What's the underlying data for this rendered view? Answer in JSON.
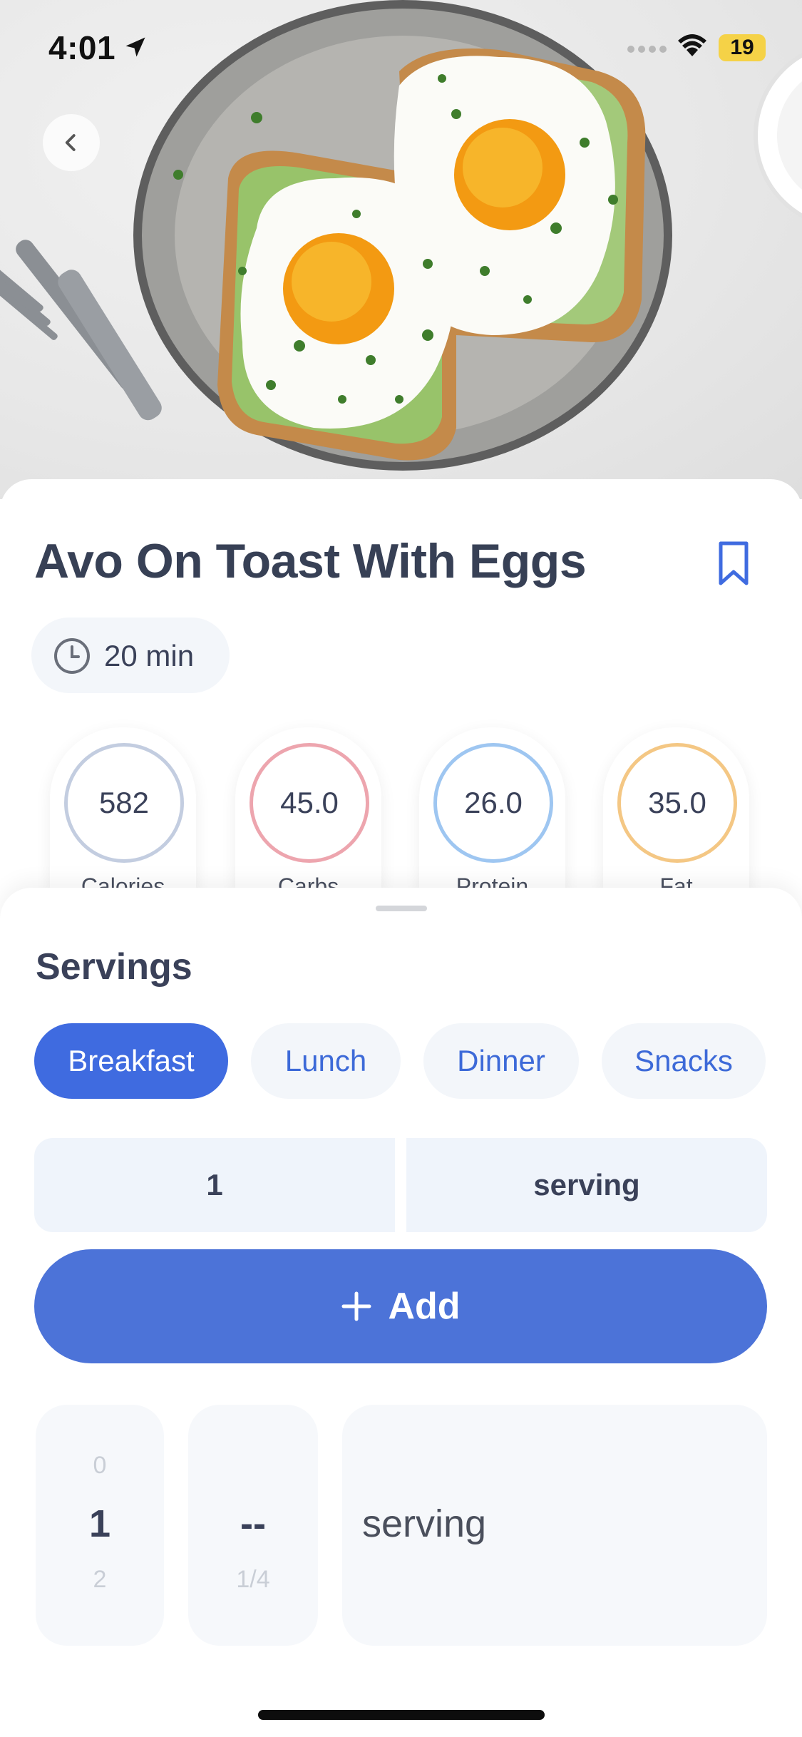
{
  "status_bar": {
    "time": "4:01",
    "battery": "19"
  },
  "recipe": {
    "title": "Avo On Toast With Eggs",
    "cook_time": "20 min"
  },
  "nutrition": [
    {
      "value": "582",
      "label": "Calories",
      "color": "#c3cde0"
    },
    {
      "value": "45.0",
      "label": "Carbs",
      "color": "#eda5ae"
    },
    {
      "value": "26.0",
      "label": "Protein",
      "color": "#9ec6f1"
    },
    {
      "value": "35.0",
      "label": "Fat",
      "color": "#f4c784"
    }
  ],
  "servings": {
    "title": "Servings",
    "meals": [
      "Breakfast",
      "Lunch",
      "Dinner",
      "Snacks"
    ],
    "selected_meal": "Breakfast",
    "quantity": "1",
    "unit": "serving",
    "add_label": "Add"
  },
  "picker": {
    "whole": {
      "above": "0",
      "selected": "1",
      "below": "2"
    },
    "fraction": {
      "selected": "--",
      "below": "1/4"
    },
    "unit": {
      "selected": "serving"
    }
  },
  "colors": {
    "accent": "#3f6be0",
    "add_button": "#4c73d8"
  }
}
